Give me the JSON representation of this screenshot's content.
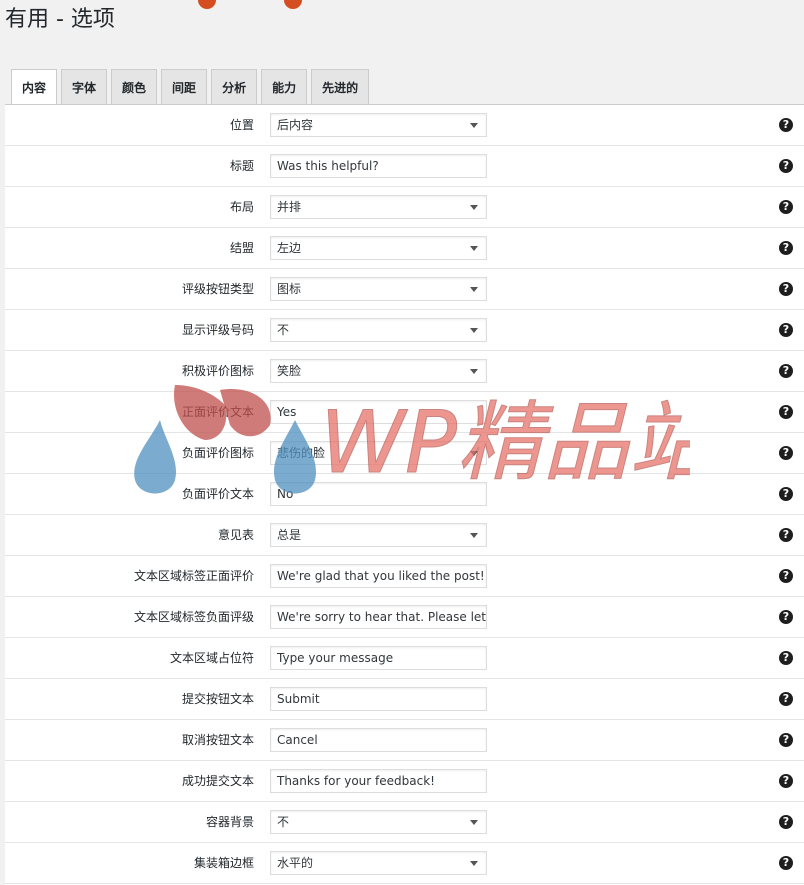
{
  "page": {
    "title": "有用 - 选项"
  },
  "tabs": [
    {
      "label": "内容",
      "active": true
    },
    {
      "label": "字体",
      "active": false
    },
    {
      "label": "颜色",
      "active": false
    },
    {
      "label": "间距",
      "active": false
    },
    {
      "label": "分析",
      "active": false
    },
    {
      "label": "能力",
      "active": false
    },
    {
      "label": "先进的",
      "active": false
    }
  ],
  "help_glyph": "?",
  "rows": [
    {
      "label": "位置",
      "type": "select",
      "value": "后内容"
    },
    {
      "label": "标题",
      "type": "text",
      "value": "Was this helpful?"
    },
    {
      "label": "布局",
      "type": "select",
      "value": "并排"
    },
    {
      "label": "结盟",
      "type": "select",
      "value": "左边"
    },
    {
      "label": "评级按钮类型",
      "type": "select",
      "value": "图标"
    },
    {
      "label": "显示评级号码",
      "type": "select",
      "value": "不"
    },
    {
      "label": "积极评价图标",
      "type": "select",
      "value": "笑脸"
    },
    {
      "label": "正面评价文本",
      "type": "text",
      "value": "Yes"
    },
    {
      "label": "负面评价图标",
      "type": "select",
      "value": "悲伤的脸"
    },
    {
      "label": "负面评价文本",
      "type": "text",
      "value": "No"
    },
    {
      "label": "意见表",
      "type": "select",
      "value": "总是"
    },
    {
      "label": "文本区域标签正面评价",
      "type": "text",
      "value": "We're glad that you liked the post! Let"
    },
    {
      "label": "文本区域标签负面评级",
      "type": "text",
      "value": "We're sorry to hear that. Please let us k"
    },
    {
      "label": "文本区域占位符",
      "type": "text",
      "value": "Type your message"
    },
    {
      "label": "提交按钮文本",
      "type": "text",
      "value": "Submit"
    },
    {
      "label": "取消按钮文本",
      "type": "text",
      "value": "Cancel"
    },
    {
      "label": "成功提交文本",
      "type": "text",
      "value": "Thanks for your feedback!"
    },
    {
      "label": "容器背景",
      "type": "select",
      "value": "不"
    },
    {
      "label": "集装箱边框",
      "type": "select",
      "value": "水平的"
    }
  ],
  "watermark": {
    "text": "WP精品站",
    "color": "#e8736a",
    "accent": "#4f8fbf"
  },
  "colors": {
    "badge": "#d54e21"
  }
}
